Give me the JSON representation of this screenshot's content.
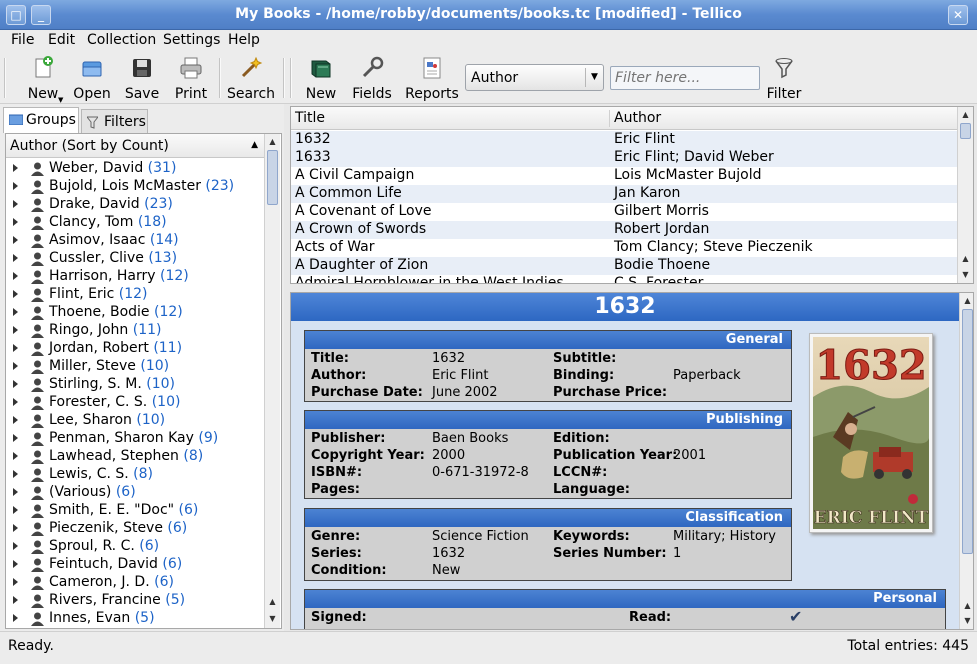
{
  "window": {
    "title": "My Books - /home/robby/documents/books.tc [modified] - Tellico"
  },
  "menu": [
    "File",
    "Edit",
    "Collection",
    "Settings",
    "Help"
  ],
  "toolbar": {
    "new": "New",
    "open": "Open",
    "save": "Save",
    "print": "Print",
    "search": "Search",
    "new_entry": "New",
    "fields": "Fields",
    "reports": "Reports",
    "field_combo": "Author",
    "filter_placeholder": "Filter here...",
    "filter": "Filter"
  },
  "left_panel": {
    "tabs": [
      "Groups",
      "Filters"
    ],
    "header": "Author (Sort by Count)",
    "groups": [
      {
        "name": "Weber, David",
        "count": "(31)"
      },
      {
        "name": "Bujold, Lois McMaster",
        "count": "(23)"
      },
      {
        "name": "Drake, David",
        "count": "(23)"
      },
      {
        "name": "Clancy, Tom",
        "count": "(18)"
      },
      {
        "name": "Asimov, Isaac",
        "count": "(14)"
      },
      {
        "name": "Cussler, Clive",
        "count": "(13)"
      },
      {
        "name": "Harrison, Harry",
        "count": "(12)"
      },
      {
        "name": "Flint, Eric",
        "count": "(12)"
      },
      {
        "name": "Thoene, Bodie",
        "count": "(12)"
      },
      {
        "name": "Ringo, John",
        "count": "(11)"
      },
      {
        "name": "Jordan, Robert",
        "count": "(11)"
      },
      {
        "name": "Miller, Steve",
        "count": "(10)"
      },
      {
        "name": "Stirling, S. M.",
        "count": "(10)"
      },
      {
        "name": "Forester, C. S.",
        "count": "(10)"
      },
      {
        "name": "Lee, Sharon",
        "count": "(10)"
      },
      {
        "name": "Penman, Sharon Kay",
        "count": "(9)"
      },
      {
        "name": "Lawhead, Stephen",
        "count": "(8)"
      },
      {
        "name": "Lewis, C. S.",
        "count": "(8)"
      },
      {
        "name": "(Various)",
        "count": "(6)"
      },
      {
        "name": "Smith, E. E. \"Doc\"",
        "count": "(6)"
      },
      {
        "name": "Pieczenik, Steve",
        "count": "(6)"
      },
      {
        "name": "Sproul, R. C.",
        "count": "(6)"
      },
      {
        "name": "Feintuch, David",
        "count": "(6)"
      },
      {
        "name": "Cameron, J. D.",
        "count": "(6)"
      },
      {
        "name": "Rivers, Francine",
        "count": "(5)"
      },
      {
        "name": "Innes, Evan",
        "count": "(5)"
      }
    ]
  },
  "book_list": {
    "columns": [
      "Title",
      "Author"
    ],
    "rows": [
      [
        "1632",
        "Eric Flint"
      ],
      [
        "1633",
        "Eric Flint; David Weber"
      ],
      [
        "A Civil Campaign",
        "Lois McMaster Bujold"
      ],
      [
        "A Common Life",
        "Jan Karon"
      ],
      [
        "A Covenant of Love",
        "Gilbert Morris"
      ],
      [
        "A Crown of Swords",
        "Robert Jordan"
      ],
      [
        "Acts of War",
        "Tom Clancy; Steve Pieczenik"
      ],
      [
        "A Daughter of Zion",
        "Bodie Thoene"
      ],
      [
        "Admiral Hornblower in the West Indies",
        "C.S. Forester"
      ]
    ]
  },
  "detail": {
    "title": "1632",
    "general": {
      "header": "General",
      "title_label": "Title:",
      "title_value": "1632",
      "subtitle_label": "Subtitle:",
      "subtitle_value": "",
      "author_label": "Author:",
      "author_value": "Eric Flint",
      "binding_label": "Binding:",
      "binding_value": "Paperback",
      "purchase_date_label": "Purchase Date:",
      "purchase_date_value": "June 2002",
      "purchase_price_label": "Purchase Price:",
      "purchase_price_value": ""
    },
    "publishing": {
      "header": "Publishing",
      "publisher_label": "Publisher:",
      "publisher_value": "Baen Books",
      "edition_label": "Edition:",
      "edition_value": "",
      "copyright_label": "Copyright Year:",
      "copyright_value": "2000",
      "pubyear_label": "Publication Year:",
      "pubyear_value": "2001",
      "isbn_label": "ISBN#:",
      "isbn_value": "0-671-31972-8",
      "lccn_label": "LCCN#:",
      "lccn_value": "",
      "pages_label": "Pages:",
      "pages_value": "",
      "language_label": "Language:",
      "language_value": ""
    },
    "classification": {
      "header": "Classification",
      "genre_label": "Genre:",
      "genre_value": "Science Fiction",
      "keywords_label": "Keywords:",
      "keywords_value": "Military; History",
      "series_label": "Series:",
      "series_value": "1632",
      "series_number_label": "Series Number:",
      "series_number_value": "1",
      "condition_label": "Condition:",
      "condition_value": "New"
    },
    "personal": {
      "header": "Personal",
      "signed_label": "Signed:",
      "read_label": "Read:"
    },
    "cover": {
      "title_text": "1632",
      "author_text": "ERIC FLINT"
    }
  },
  "status": {
    "left": "Ready.",
    "right": "Total entries: 445"
  }
}
